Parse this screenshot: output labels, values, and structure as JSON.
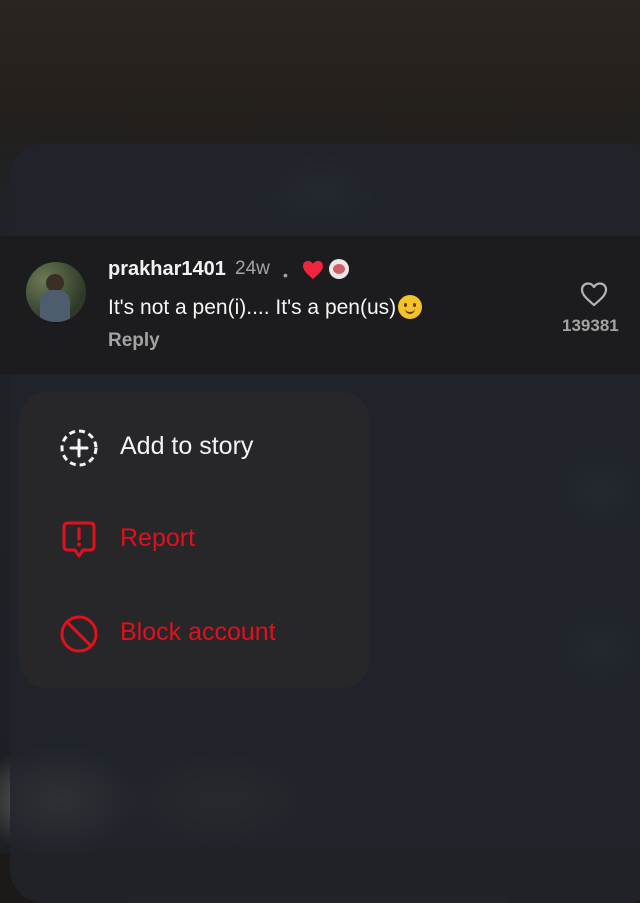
{
  "comment": {
    "username": "prakhar1401",
    "time": "24w",
    "separator": "•",
    "text": "It's not a pen(i).... It's a pen(us)",
    "reply_label": "Reply",
    "like_count": "139381"
  },
  "menu": {
    "add_to_story": "Add to story",
    "report": "Report",
    "block_account": "Block account"
  },
  "colors": {
    "danger": "#e0101e",
    "heart": "#f0243c",
    "menu_background": "#27272a"
  },
  "icons": {
    "add_to_story": "dashed-circle-plus-icon",
    "report": "speech-bubble-exclamation-icon",
    "block": "block-circle-icon",
    "like": "heart-outline-icon"
  }
}
